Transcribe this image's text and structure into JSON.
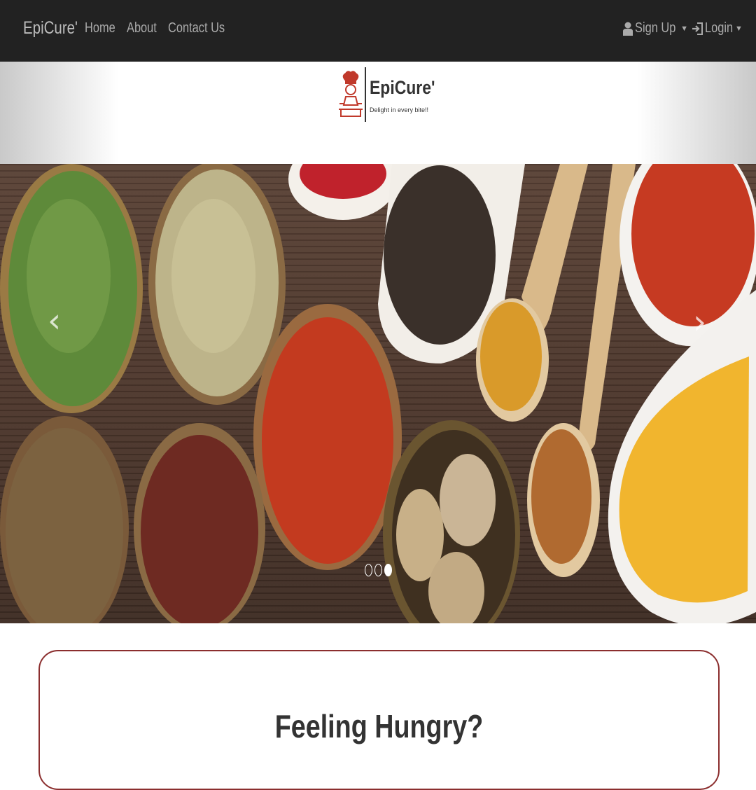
{
  "navbar": {
    "brand": "EpiCure'",
    "links": [
      "Home",
      "About",
      "Contact Us"
    ],
    "signup": {
      "label": "Sign Up",
      "icon": "user-icon"
    },
    "login": {
      "label": "Login",
      "icon": "login-icon"
    }
  },
  "logo": {
    "title": "EpiCure'",
    "tagline": "Delight in every bite!!"
  },
  "carousel": {
    "prev": "‹",
    "next": "›",
    "slide_count": 3,
    "active_slide": 3
  },
  "card": {
    "title": "Feeling Hungry?"
  },
  "colors": {
    "navbar_bg": "#222222",
    "accent": "#8b2e2e"
  }
}
